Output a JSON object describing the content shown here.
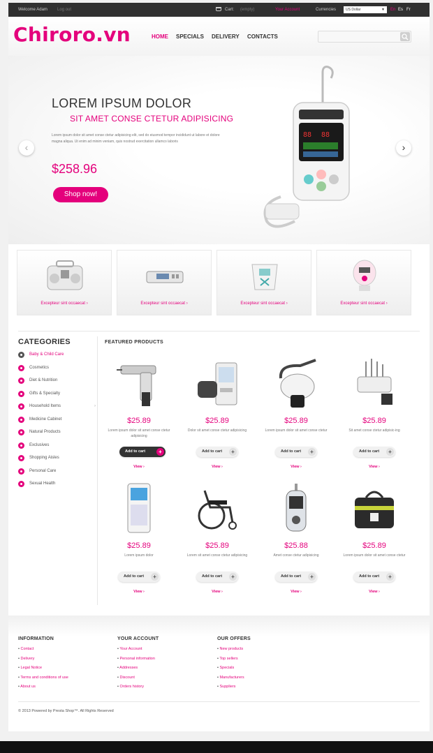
{
  "topbar": {
    "welcome": "Welcome Adam",
    "login": "Log out",
    "cart": "Cart:",
    "cart_status": "(empty)",
    "checkout": "Your Account",
    "currency_label": "Currencies",
    "currency_value": "US Dollar",
    "languages": [
      "En",
      "Es",
      "Fr"
    ]
  },
  "header": {
    "logo": "Chiroro.vn",
    "menu": [
      "HOME",
      "SPECIALS",
      "DELIVERY",
      "CONTACTS"
    ],
    "search_placeholder": ""
  },
  "slider": {
    "title": "LOREM IPSUM DOLOR",
    "subtitle": "SIT AMET CONSE CTETUR ADIPISICING",
    "text": "Lorem ipsum dolor sit amet conse ctetur adipisicing elit, sed do eiusmod tempor incididunt ut labore et dolore magna aliqua. Ut enim ad minim veniam, quis nostrud exercitation ullamco laboris",
    "price": "$258.96",
    "button": "Shop now!",
    "prev": "‹",
    "next": "›"
  },
  "promos": [
    {
      "label": "Excepteur sint occaecat",
      "arrow": "›"
    },
    {
      "label": "Excepteur sint occaecat",
      "arrow": "›"
    },
    {
      "label": "Excepteur sint occaecat",
      "arrow": "›"
    },
    {
      "label": "Excepteur sint occaecat",
      "arrow": "›"
    }
  ],
  "categories": {
    "title": "CATEGORIES",
    "items": [
      "Baby & Child Care",
      "Cosmetics",
      "Diet & Nutrition",
      "Gifts & Specialty",
      "Household Items",
      "Medicine Cabinet",
      "Natural Products",
      "Exclusives",
      "Shopping Aisles",
      "Personal Care",
      "Sexual Health"
    ],
    "more": "›"
  },
  "featured": {
    "title": "FEATURED PRODUCTS",
    "add_label": "Add to cart",
    "view_label": "View ›",
    "products": [
      {
        "price": "$25.89",
        "desc": "Lorem ipsum dolor sit amet conse ctetur adipisicing"
      },
      {
        "price": "$25.89",
        "desc": "Dolor sit amet conse ctetur adipisicing"
      },
      {
        "price": "$25.89",
        "desc": "Lorem ipsum dolor sit amet conse ctetur"
      },
      {
        "price": "$25.89",
        "desc": "Sit amet conse ctetur adipisic-ing"
      },
      {
        "price": "$25.89",
        "desc": "Lorem ipsum dolor"
      },
      {
        "price": "$25.89",
        "desc": "Lorem sit amet conse ctetur adipisicing"
      },
      {
        "price": "$25.88",
        "desc": "Amet conse ctetur adipisicing"
      },
      {
        "price": "$25.89",
        "desc": "Lorem ipsum dolor sit amet conse ctetur"
      }
    ]
  },
  "footer": {
    "columns": [
      {
        "title": "INFORMATION",
        "items": [
          "Contact",
          "Delivery",
          "Legal Notice",
          "Terms and conditions of use",
          "About us"
        ]
      },
      {
        "title": "YOUR ACCOUNT",
        "items": [
          "Your Account",
          "Personal information",
          "Addresses",
          "Discount",
          "Orders history"
        ]
      },
      {
        "title": "OUR OFFERS",
        "items": [
          "New products",
          "Top sellers",
          "Specials",
          "Manufacturers",
          "Suppliers"
        ]
      }
    ],
    "copyright": "© 2013 Powered by Presta Shop™. All Rights Reserved"
  },
  "colors": {
    "accent": "#e4007c",
    "topbar": "#303030"
  }
}
